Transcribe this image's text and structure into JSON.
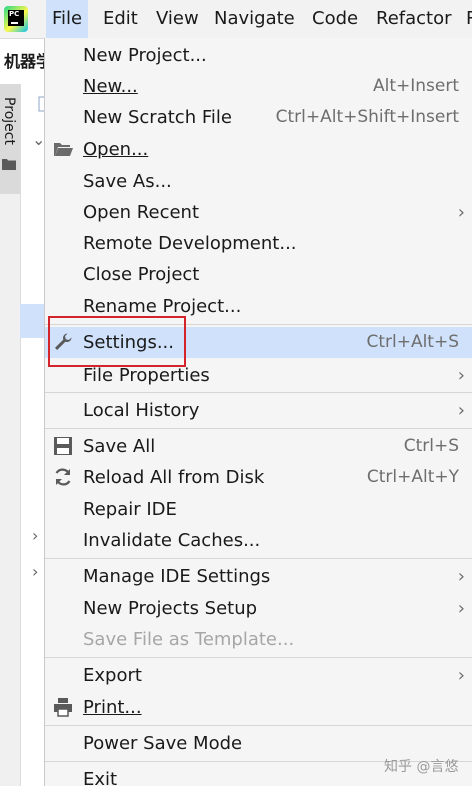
{
  "menubar": {
    "logo_text": "PC",
    "items": [
      {
        "label": "File",
        "active": true
      },
      {
        "label": "Edit"
      },
      {
        "label": "View"
      },
      {
        "label": "Navigate"
      },
      {
        "label": "Code"
      },
      {
        "label": "Refactor"
      },
      {
        "label": "R"
      }
    ]
  },
  "background": {
    "project_title": "机器学",
    "side_tab_label": "Project"
  },
  "file_menu": {
    "items": [
      {
        "label": "New Project..."
      },
      {
        "label": "New...",
        "shortcut": "Alt+Insert"
      },
      {
        "label": "New Scratch File",
        "shortcut": "Ctrl+Alt+Shift+Insert"
      },
      {
        "label": "Open...",
        "icon": "folder-open-icon"
      },
      {
        "label": "Save As..."
      },
      {
        "label": "Open Recent",
        "submenu": true
      },
      {
        "label": "Remote Development..."
      },
      {
        "label": "Close Project"
      },
      {
        "label": "Rename Project..."
      },
      {
        "label": "Settings...",
        "shortcut": "Ctrl+Alt+S",
        "icon": "wrench-icon",
        "highlighted": true
      },
      {
        "label": "File Properties",
        "submenu": true
      },
      {
        "label": "Local History",
        "submenu": true
      },
      {
        "label": "Save All",
        "shortcut": "Ctrl+S",
        "icon": "save-icon"
      },
      {
        "label": "Reload All from Disk",
        "shortcut": "Ctrl+Alt+Y",
        "icon": "reload-icon"
      },
      {
        "label": "Repair IDE"
      },
      {
        "label": "Invalidate Caches..."
      },
      {
        "label": "Manage IDE Settings",
        "submenu": true
      },
      {
        "label": "New Projects Setup",
        "submenu": true
      },
      {
        "label": "Save File as Template...",
        "disabled": true
      },
      {
        "label": "Export",
        "submenu": true
      },
      {
        "label": "Print...",
        "icon": "print-icon"
      },
      {
        "label": "Power Save Mode"
      },
      {
        "label": "Exit"
      }
    ],
    "submenu_glyph": "›"
  },
  "watermark": "知乎 @言悠",
  "colors": {
    "highlight": "#cfe1fb",
    "annotation_box": "#d3232b",
    "menu_bg": "#f5f5f5"
  }
}
